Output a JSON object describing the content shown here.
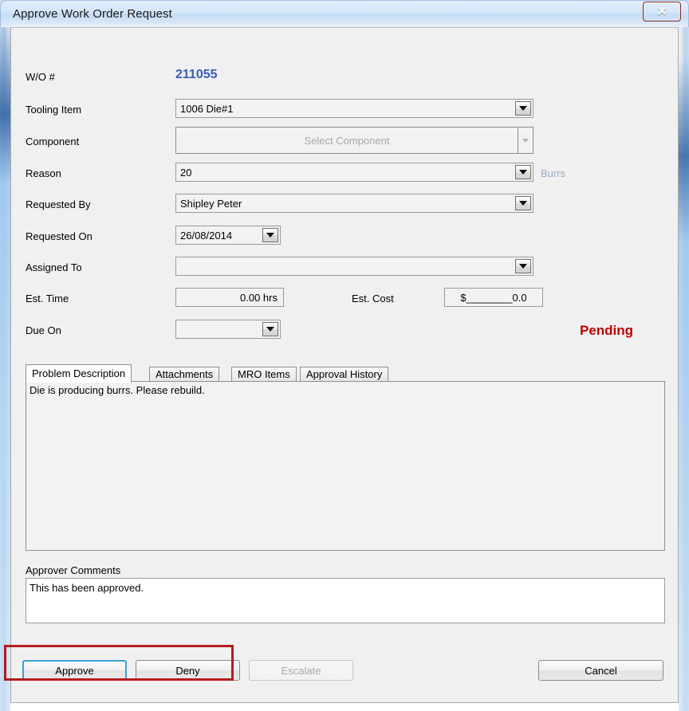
{
  "window": {
    "title": "Approve Work Order Request",
    "close_label": "✕",
    "close_icon": "close-icon"
  },
  "form": {
    "wo_number_label": "W/O #",
    "wo_number_value": "211055",
    "wo_number_color": "#3b5bbf",
    "fields": [
      {
        "label": "Tooling Item",
        "value": "1006 Die#1"
      },
      {
        "label": "Component",
        "value": "Select Component"
      },
      {
        "label": "Reason",
        "value": "20",
        "hint": "Burrs"
      },
      {
        "label": "Requested By",
        "value": "Shipley Peter"
      },
      {
        "label": "Requested On",
        "value": "26/08/2014"
      },
      {
        "label": "Assigned To",
        "value": ""
      },
      {
        "label": "Est. Time",
        "value": "0.00 hrs"
      },
      {
        "label": "Est. Cost",
        "value": "$________0.0"
      },
      {
        "label": "Due On",
        "value": ""
      }
    ],
    "status": "Pending",
    "status_color": "#c00000"
  },
  "tabs": [
    {
      "label": "Problem Description",
      "active": true
    },
    {
      "label": "Attachments",
      "active": false
    },
    {
      "label": "MRO Items",
      "active": false
    },
    {
      "label": "Approval History",
      "active": false
    }
  ],
  "problem_description": "Die is producing burrs.  Please rebuild.",
  "approver": {
    "label": "Approver Comments",
    "comment": "This has been approved."
  },
  "buttons": {
    "approve": "Approve",
    "deny": "Deny",
    "escalate": "Escalate",
    "cancel": "Cancel"
  },
  "annotation": {
    "color": "#b51c1c"
  }
}
